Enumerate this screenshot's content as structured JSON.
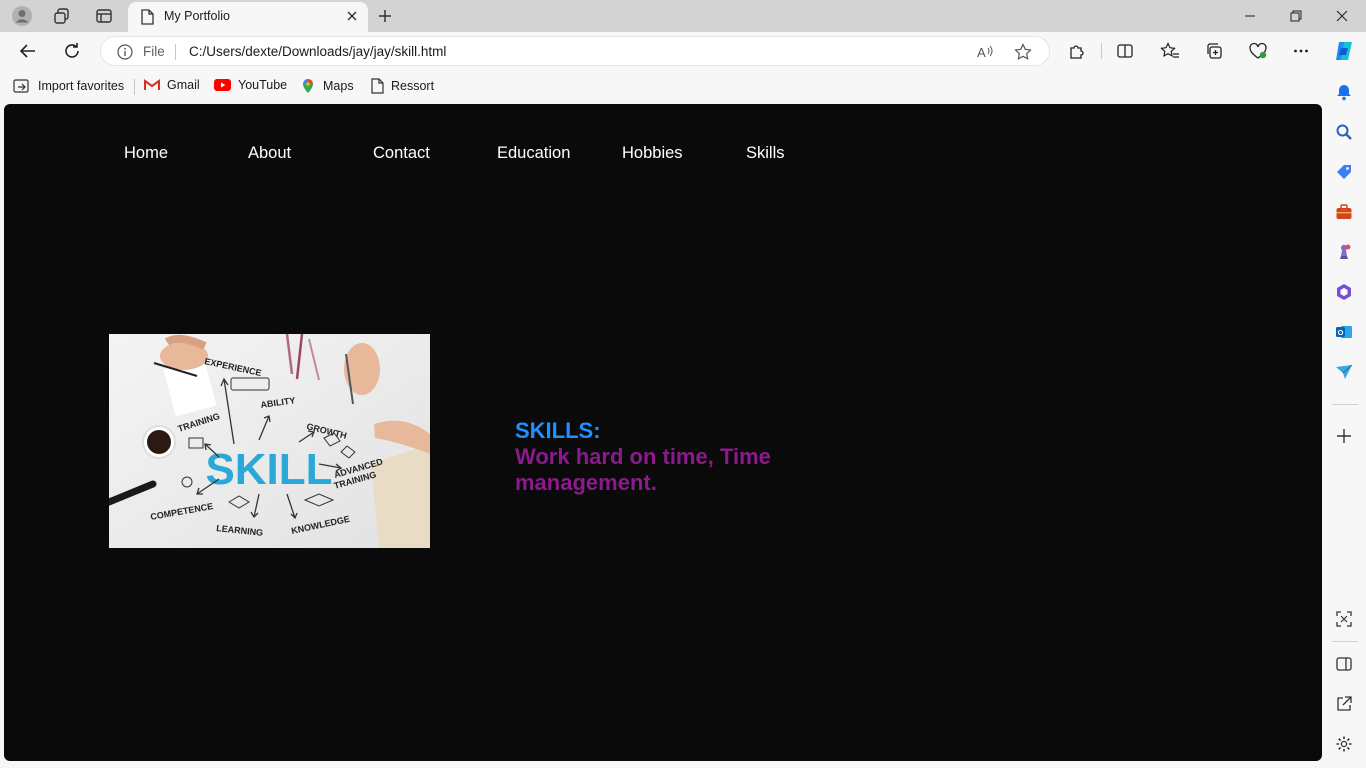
{
  "browser": {
    "tab_title": "My Portfolio",
    "address": {
      "scheme_label": "File",
      "url": "C:/Users/dexte/Downloads/jay/jay/skill.html"
    },
    "favorites": [
      {
        "label": "Import favorites",
        "icon": "import-icon"
      },
      {
        "label": "Gmail",
        "icon": "gmail-icon"
      },
      {
        "label": "YouTube",
        "icon": "youtube-icon"
      },
      {
        "label": "Maps",
        "icon": "maps-icon"
      },
      {
        "label": "Ressort",
        "icon": "page-icon"
      }
    ],
    "sidebar_icons": [
      "bell-icon",
      "search-icon",
      "tag-icon",
      "briefcase-icon",
      "chess-icon",
      "copilot-icon",
      "outlook-icon",
      "send-icon",
      "add-icon",
      "screenshot-icon",
      "split-screen-icon",
      "external-link-icon",
      "settings-icon"
    ]
  },
  "page": {
    "nav": [
      "Home",
      "About",
      "Contact",
      "Education",
      "Hobbies",
      "Skills"
    ],
    "image": {
      "center_word": "SKILL",
      "labels": [
        "EXPERIENCE",
        "ABILITY",
        "TRAINING",
        "GROWTH",
        "ADVANCED",
        "TRAINING",
        "COMPETENCE",
        "LEARNING",
        "KNOWLEDGE"
      ]
    },
    "skills_heading": "SKILLS:",
    "skills_text": "Work hard on time, Time management."
  },
  "colors": {
    "page_bg": "#0a0a0b",
    "heading": "#1e90ff",
    "body_text": "#8b1a8b",
    "nav_text": "#ffffff"
  }
}
